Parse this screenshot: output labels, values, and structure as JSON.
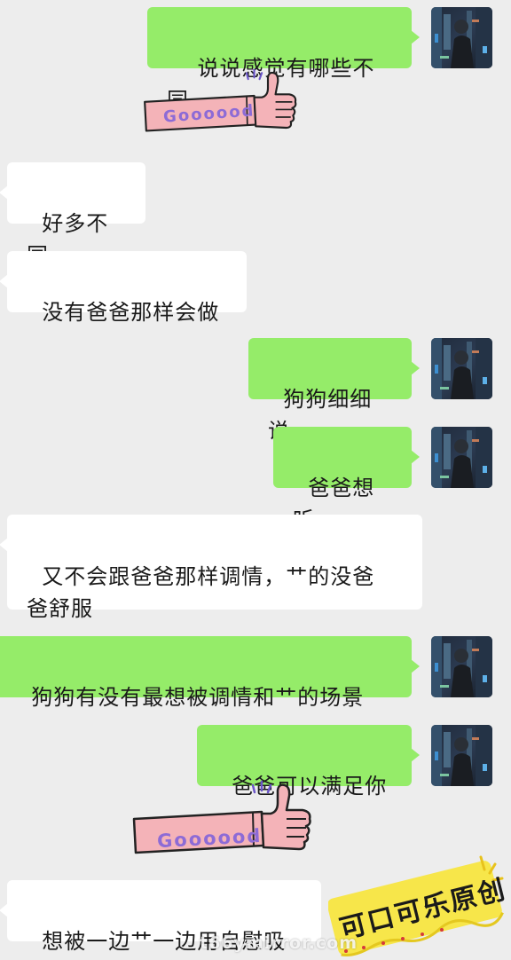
{
  "conversation": {
    "messages": [
      {
        "sender": "me",
        "text": "说说感觉有哪些不同"
      },
      {
        "sender": "me",
        "sticker": "thumbs-up",
        "sticker_text": "Goooood"
      },
      {
        "sender": "other",
        "text": "好多不同"
      },
      {
        "sender": "other",
        "text": "没有爸爸那样会做"
      },
      {
        "sender": "me",
        "text": "狗狗细细说"
      },
      {
        "sender": "me",
        "text": "爸爸想听"
      },
      {
        "sender": "other",
        "text": "又不会跟爸爸那样调情，艹的没爸\n爸舒服"
      },
      {
        "sender": "me",
        "text": "狗狗有没有最想被调情和艹的场景"
      },
      {
        "sender": "me",
        "text": "爸爸可以满足你"
      },
      {
        "sender": "me",
        "sticker": "thumbs-up",
        "sticker_text": "Goooood"
      },
      {
        "sender": "other",
        "text": "想被一边艹一边用自慰吸"
      }
    ]
  },
  "overlay": {
    "stamp_text": "可口可乐原创",
    "watermark_text": "t66ymirror.com"
  },
  "colors": {
    "background": "#ededed",
    "my_bubble": "#95ec69",
    "other_bubble": "#ffffff",
    "sticker_arm": "#f4b3b8",
    "sticker_text": "#8d6bd6"
  }
}
